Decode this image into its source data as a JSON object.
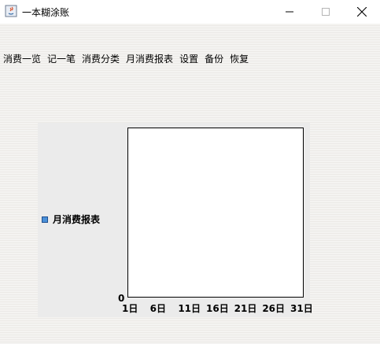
{
  "window": {
    "title": "一本糊涂账",
    "controls": {
      "minimize": "minimize-icon",
      "maximize": "maximize-icon",
      "close": "close-icon"
    }
  },
  "menu": [
    "消费一览",
    "记一笔",
    "消费分类",
    "月消费报表",
    "设置",
    "备份",
    "恢复"
  ],
  "chart_data": {
    "type": "bar",
    "legend": [
      "月消费报表"
    ],
    "x_ticks": [
      "1日",
      "6日",
      "11日",
      "16日",
      "21日",
      "26日",
      "31日"
    ],
    "y_ticks": [
      "0"
    ],
    "series": [
      {
        "name": "月消费报表",
        "values": []
      }
    ],
    "legend_position": "left",
    "colors": {
      "series": "#4a90d9"
    }
  }
}
